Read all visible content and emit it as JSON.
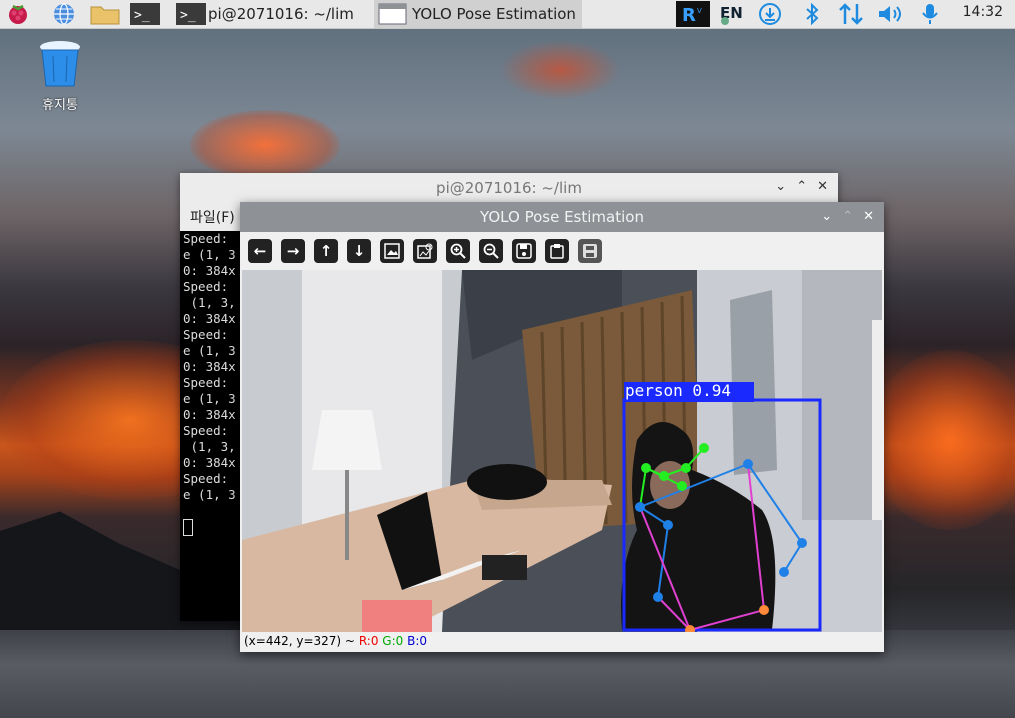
{
  "taskbar": {
    "tasks": [
      {
        "label": "pi@2071016: ~/lim"
      },
      {
        "label": "YOLO Pose Estimation"
      }
    ],
    "tray": {
      "keyboard": "EN"
    },
    "clock": "14:32"
  },
  "desktop": {
    "trash_label": "휴지통"
  },
  "terminal": {
    "title": "pi@2071016: ~/lim",
    "menu_file": "파일(F)",
    "lines": [
      "Speed:",
      "e (1, 3",
      "",
      "0: 384x",
      "Speed:",
      " (1, 3,",
      "",
      "0: 384x",
      "Speed:",
      "e (1, 3",
      "",
      "0: 384x",
      "Speed:",
      "e (1, 3",
      "",
      "0: 384x",
      "Speed:",
      " (1, 3,",
      "",
      "0: 384x",
      "Speed:",
      "e (1, 3"
    ]
  },
  "yolo": {
    "title": "YOLO Pose Estimation",
    "detection_label": "person 0.94",
    "status": {
      "coords": "(x=442, y=327) ~",
      "r": "R:0",
      "g": "G:0",
      "b": "B:0"
    }
  },
  "colors": {
    "bbox": "#1a2aff",
    "keypoint_green": "#22ee22",
    "keypoint_blue": "#1f80e8",
    "keypoint_orange": "#ff8a3a",
    "limb_magenta": "#e040d0"
  }
}
